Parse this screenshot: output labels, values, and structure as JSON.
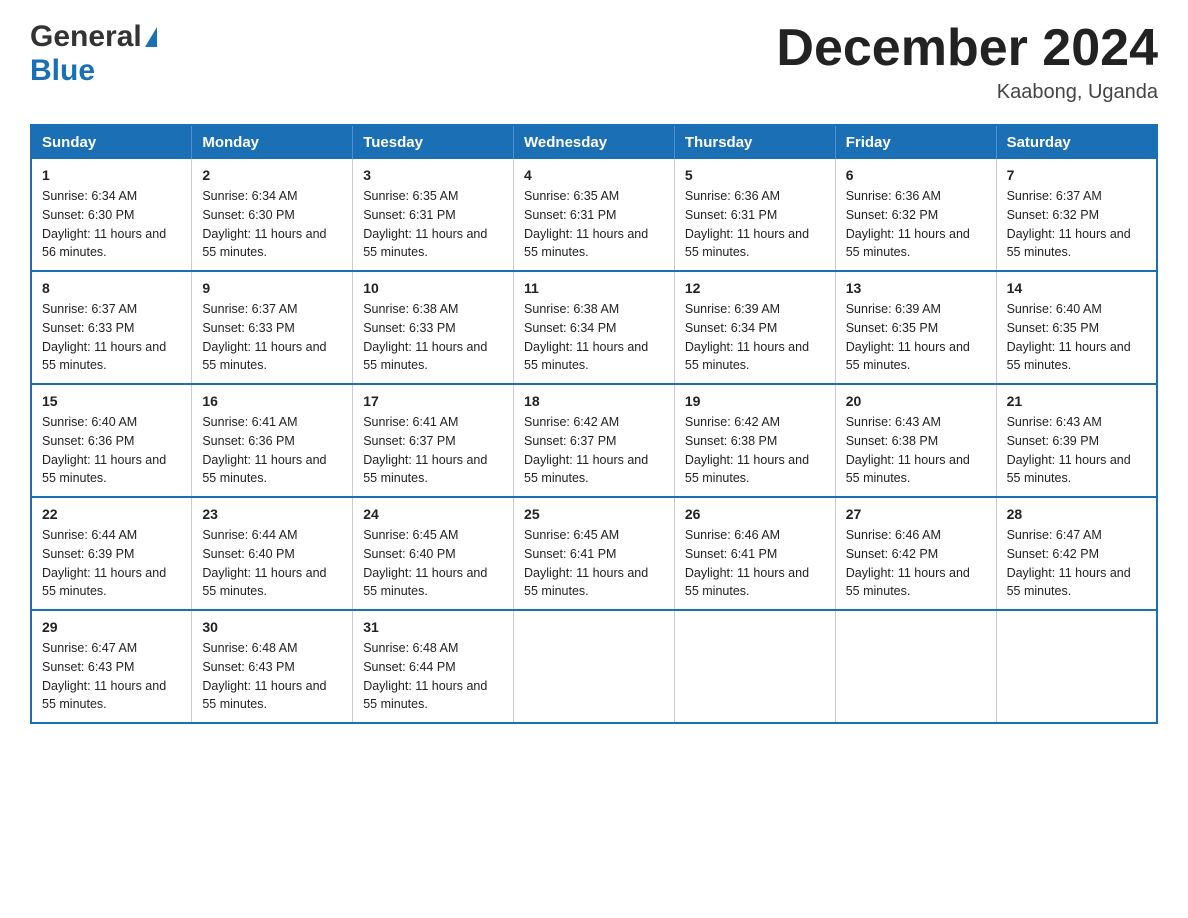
{
  "header": {
    "logo_general": "General",
    "logo_blue": "Blue",
    "month_title": "December 2024",
    "location": "Kaabong, Uganda"
  },
  "days_of_week": [
    "Sunday",
    "Monday",
    "Tuesday",
    "Wednesday",
    "Thursday",
    "Friday",
    "Saturday"
  ],
  "weeks": [
    [
      {
        "day": "1",
        "sunrise": "6:34 AM",
        "sunset": "6:30 PM",
        "daylight": "11 hours and 56 minutes."
      },
      {
        "day": "2",
        "sunrise": "6:34 AM",
        "sunset": "6:30 PM",
        "daylight": "11 hours and 55 minutes."
      },
      {
        "day": "3",
        "sunrise": "6:35 AM",
        "sunset": "6:31 PM",
        "daylight": "11 hours and 55 minutes."
      },
      {
        "day": "4",
        "sunrise": "6:35 AM",
        "sunset": "6:31 PM",
        "daylight": "11 hours and 55 minutes."
      },
      {
        "day": "5",
        "sunrise": "6:36 AM",
        "sunset": "6:31 PM",
        "daylight": "11 hours and 55 minutes."
      },
      {
        "day": "6",
        "sunrise": "6:36 AM",
        "sunset": "6:32 PM",
        "daylight": "11 hours and 55 minutes."
      },
      {
        "day": "7",
        "sunrise": "6:37 AM",
        "sunset": "6:32 PM",
        "daylight": "11 hours and 55 minutes."
      }
    ],
    [
      {
        "day": "8",
        "sunrise": "6:37 AM",
        "sunset": "6:33 PM",
        "daylight": "11 hours and 55 minutes."
      },
      {
        "day": "9",
        "sunrise": "6:37 AM",
        "sunset": "6:33 PM",
        "daylight": "11 hours and 55 minutes."
      },
      {
        "day": "10",
        "sunrise": "6:38 AM",
        "sunset": "6:33 PM",
        "daylight": "11 hours and 55 minutes."
      },
      {
        "day": "11",
        "sunrise": "6:38 AM",
        "sunset": "6:34 PM",
        "daylight": "11 hours and 55 minutes."
      },
      {
        "day": "12",
        "sunrise": "6:39 AM",
        "sunset": "6:34 PM",
        "daylight": "11 hours and 55 minutes."
      },
      {
        "day": "13",
        "sunrise": "6:39 AM",
        "sunset": "6:35 PM",
        "daylight": "11 hours and 55 minutes."
      },
      {
        "day": "14",
        "sunrise": "6:40 AM",
        "sunset": "6:35 PM",
        "daylight": "11 hours and 55 minutes."
      }
    ],
    [
      {
        "day": "15",
        "sunrise": "6:40 AM",
        "sunset": "6:36 PM",
        "daylight": "11 hours and 55 minutes."
      },
      {
        "day": "16",
        "sunrise": "6:41 AM",
        "sunset": "6:36 PM",
        "daylight": "11 hours and 55 minutes."
      },
      {
        "day": "17",
        "sunrise": "6:41 AM",
        "sunset": "6:37 PM",
        "daylight": "11 hours and 55 minutes."
      },
      {
        "day": "18",
        "sunrise": "6:42 AM",
        "sunset": "6:37 PM",
        "daylight": "11 hours and 55 minutes."
      },
      {
        "day": "19",
        "sunrise": "6:42 AM",
        "sunset": "6:38 PM",
        "daylight": "11 hours and 55 minutes."
      },
      {
        "day": "20",
        "sunrise": "6:43 AM",
        "sunset": "6:38 PM",
        "daylight": "11 hours and 55 minutes."
      },
      {
        "day": "21",
        "sunrise": "6:43 AM",
        "sunset": "6:39 PM",
        "daylight": "11 hours and 55 minutes."
      }
    ],
    [
      {
        "day": "22",
        "sunrise": "6:44 AM",
        "sunset": "6:39 PM",
        "daylight": "11 hours and 55 minutes."
      },
      {
        "day": "23",
        "sunrise": "6:44 AM",
        "sunset": "6:40 PM",
        "daylight": "11 hours and 55 minutes."
      },
      {
        "day": "24",
        "sunrise": "6:45 AM",
        "sunset": "6:40 PM",
        "daylight": "11 hours and 55 minutes."
      },
      {
        "day": "25",
        "sunrise": "6:45 AM",
        "sunset": "6:41 PM",
        "daylight": "11 hours and 55 minutes."
      },
      {
        "day": "26",
        "sunrise": "6:46 AM",
        "sunset": "6:41 PM",
        "daylight": "11 hours and 55 minutes."
      },
      {
        "day": "27",
        "sunrise": "6:46 AM",
        "sunset": "6:42 PM",
        "daylight": "11 hours and 55 minutes."
      },
      {
        "day": "28",
        "sunrise": "6:47 AM",
        "sunset": "6:42 PM",
        "daylight": "11 hours and 55 minutes."
      }
    ],
    [
      {
        "day": "29",
        "sunrise": "6:47 AM",
        "sunset": "6:43 PM",
        "daylight": "11 hours and 55 minutes."
      },
      {
        "day": "30",
        "sunrise": "6:48 AM",
        "sunset": "6:43 PM",
        "daylight": "11 hours and 55 minutes."
      },
      {
        "day": "31",
        "sunrise": "6:48 AM",
        "sunset": "6:44 PM",
        "daylight": "11 hours and 55 minutes."
      },
      null,
      null,
      null,
      null
    ]
  ],
  "labels": {
    "sunrise": "Sunrise:",
    "sunset": "Sunset:",
    "daylight": "Daylight:"
  }
}
